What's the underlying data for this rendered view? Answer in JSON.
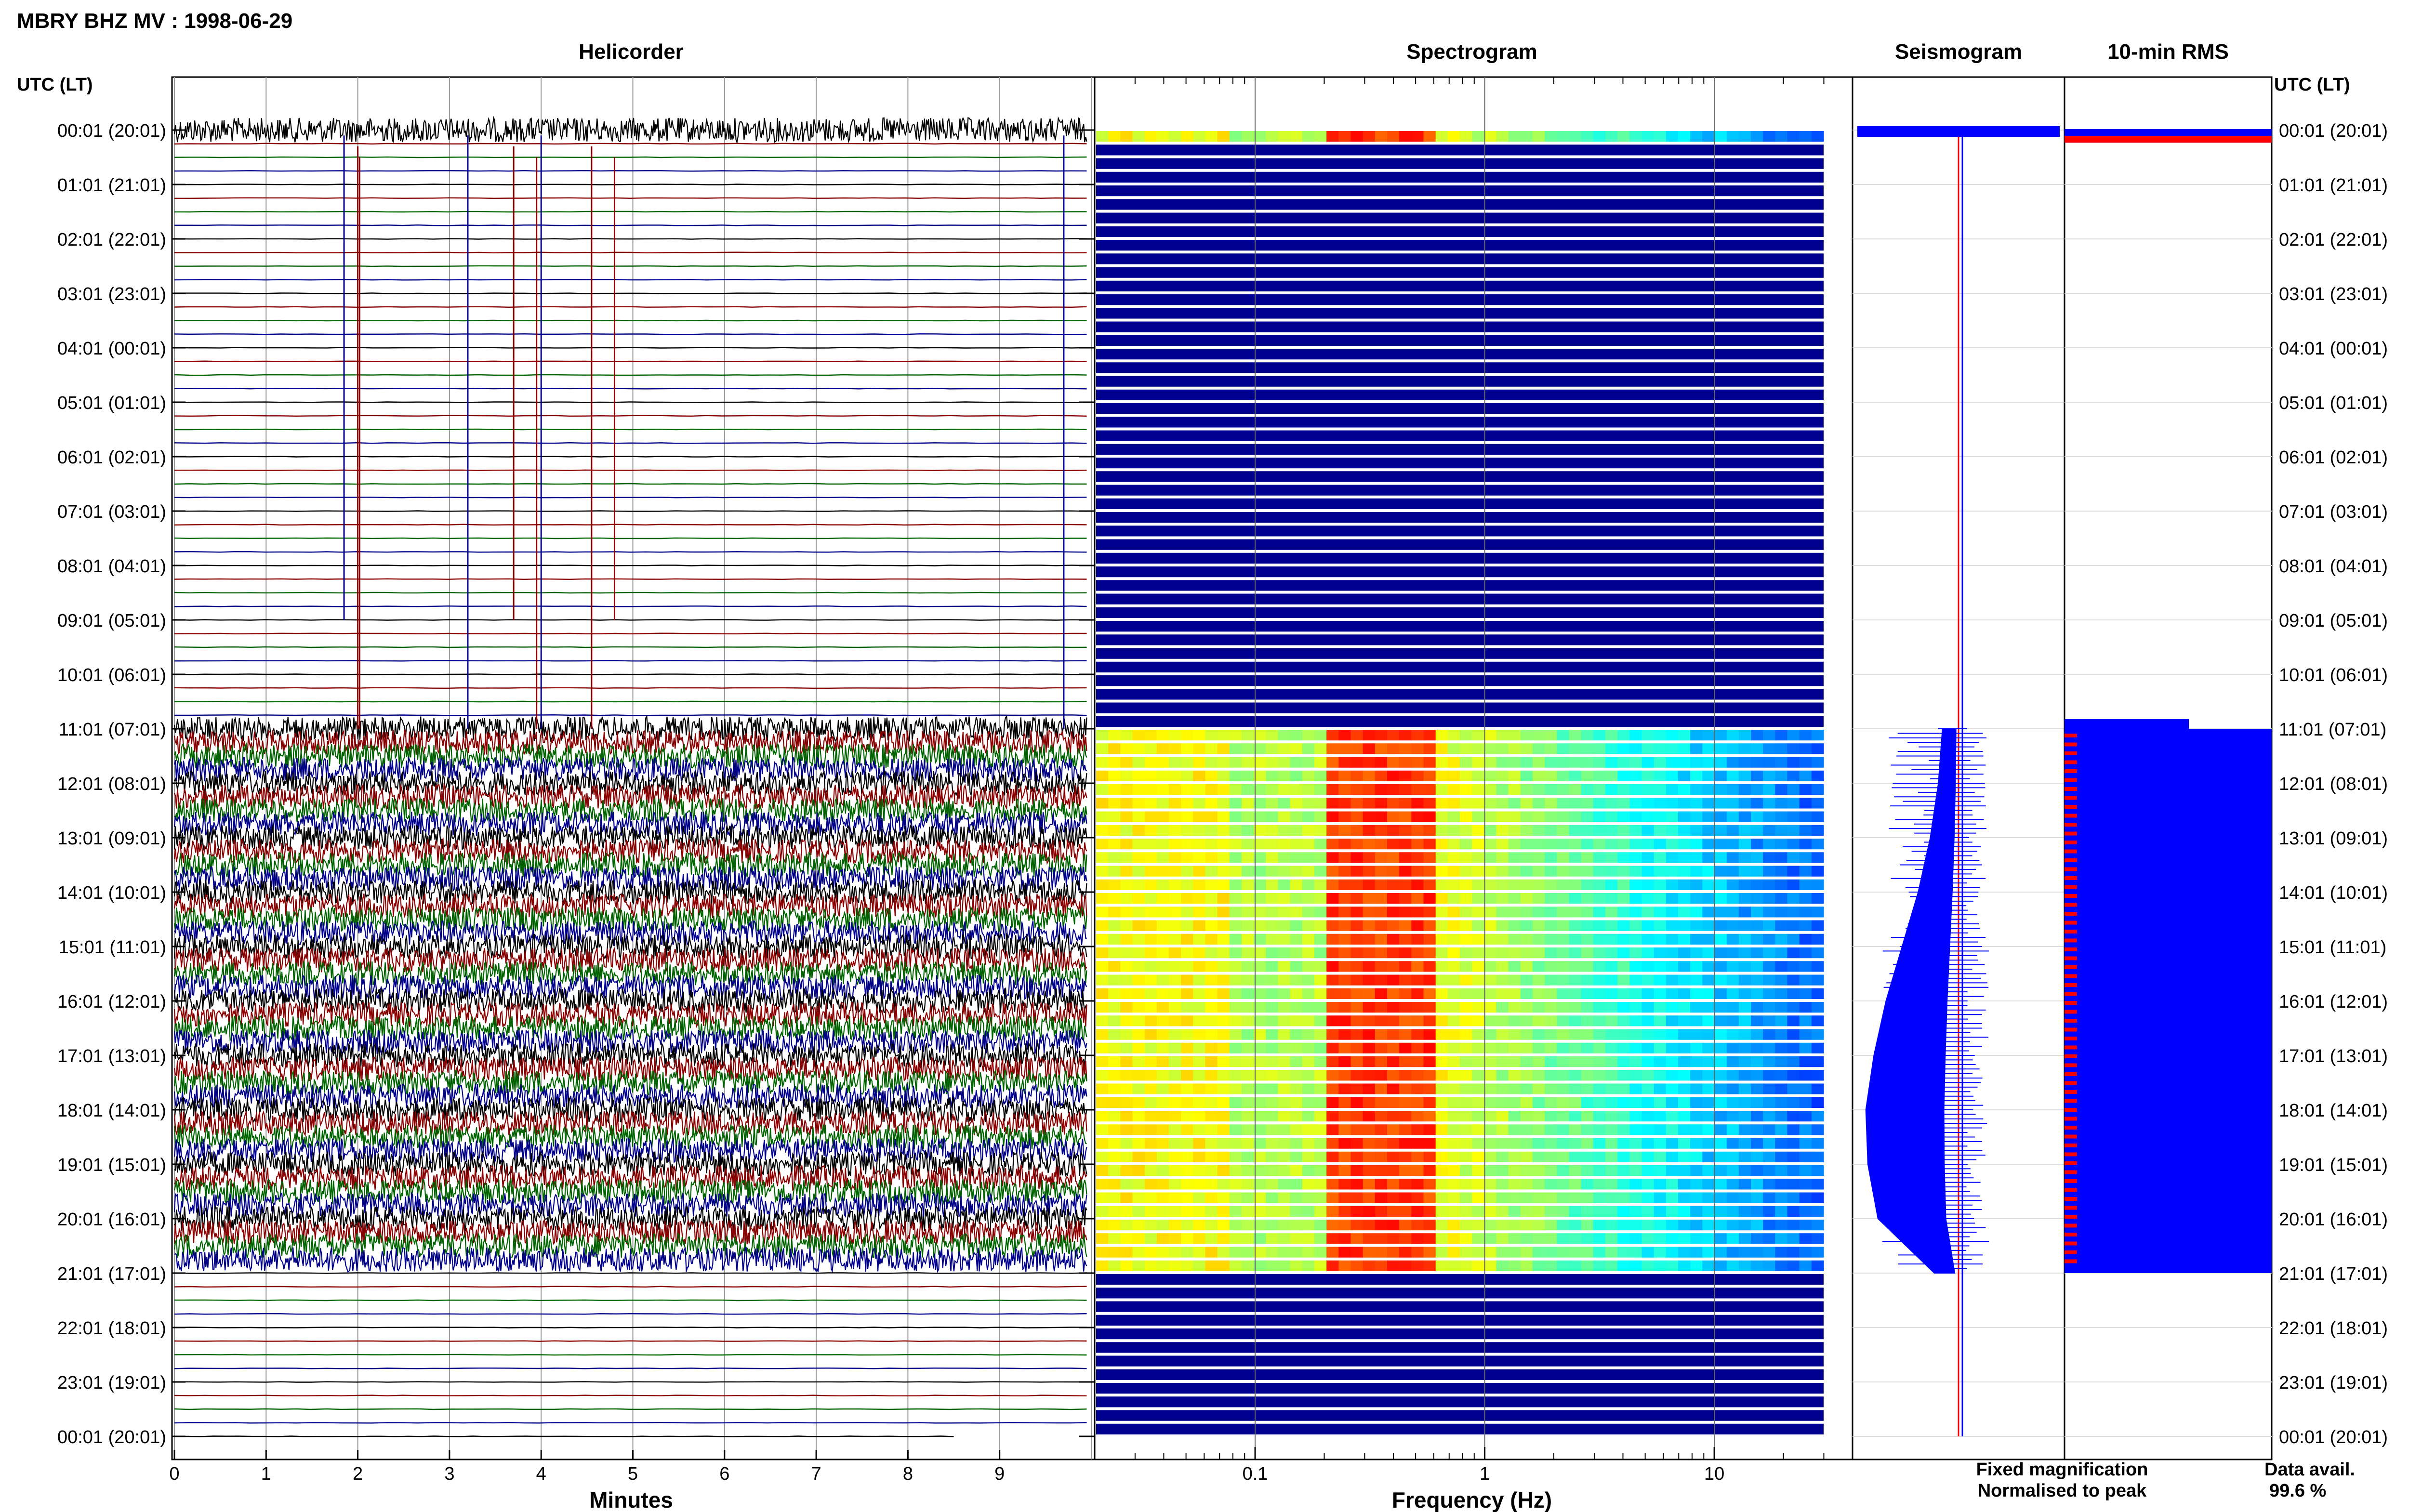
{
  "title": "MBRY BHZ MV : 1998-06-29",
  "panels": {
    "helicorder": "Helicorder",
    "spectrogram": "Spectrogram",
    "seismogram": "Seismogram",
    "rms": "10-min RMS"
  },
  "utc_lt_label": "UTC (LT)",
  "legend": {
    "fixed": "Fixed magnification",
    "normalised": "Normalised to peak",
    "fixed_color": "#0000ff",
    "normalised_color": "#ff0000"
  },
  "data_availability": {
    "label": "Data avail.",
    "value": "99.6 %"
  },
  "chart_data": [
    {
      "type": "line",
      "panel": "Helicorder",
      "xlabel": "Minutes",
      "xlim": [
        0,
        10
      ],
      "x_ticks": [
        "0",
        "1",
        "2",
        "3",
        "4",
        "5",
        "6",
        "7",
        "8",
        "9"
      ],
      "row_labels": [
        "00:01 (20:01)",
        "01:01 (21:01)",
        "02:01 (22:01)",
        "03:01 (23:01)",
        "04:01 (00:01)",
        "05:01 (01:01)",
        "06:01 (02:01)",
        "07:01 (03:01)",
        "08:01 (04:01)",
        "09:01 (05:01)",
        "10:01 (06:01)",
        "11:01 (07:01)",
        "12:01 (08:01)",
        "13:01 (09:01)",
        "14:01 (10:01)",
        "15:01 (11:01)",
        "16:01 (12:01)",
        "17:01 (13:01)",
        "18:01 (14:01)",
        "19:01 (15:01)",
        "20:01 (16:01)",
        "21:01 (17:01)",
        "22:01 (18:01)",
        "23:01 (19:01)",
        "00:01 (20:01)"
      ],
      "trace_colors": [
        "#000000",
        "#8b0000",
        "#006400",
        "#00008b"
      ],
      "active_rows_hours": [
        [
          0.0,
          0.25
        ],
        [
          11.0,
          21.0
        ]
      ],
      "noise_amplitude": {
        "quiet": 0.02,
        "active": 0.9
      },
      "spikes_minutes": [
        1.85,
        2.0,
        2.02,
        3.2,
        3.7,
        3.95,
        4.0,
        4.55,
        4.8,
        9.7
      ]
    },
    {
      "type": "heatmap",
      "panel": "Spectrogram",
      "xlabel": "Frequency (Hz)",
      "x_scale": "log",
      "xlim": [
        0.02,
        40
      ],
      "x_ticks": [
        "0.1",
        "1",
        "10"
      ],
      "colormap": "jet",
      "active_rows_hours": [
        [
          0.0,
          0.25
        ],
        [
          11.0,
          21.0
        ]
      ],
      "peak_band_hz": [
        0.2,
        0.6
      ]
    },
    {
      "type": "area",
      "panel": "Seismogram",
      "color": "#0000ff",
      "active_hours": [
        11.0,
        21.0
      ],
      "half_width_relative": [
        0.08,
        0.1,
        0.14,
        0.2,
        0.28,
        0.36,
        0.42,
        0.46,
        0.45,
        0.4,
        0.12
      ],
      "hours": [
        11,
        12,
        13,
        14,
        15,
        16,
        17,
        18,
        19,
        20,
        21
      ]
    },
    {
      "type": "bar",
      "panel": "10-min RMS",
      "fixed_color": "#0000ff",
      "normalised_color": "#ff0000",
      "active_hours": [
        11.0,
        21.0
      ],
      "fixed_level_relative": 1.0,
      "normalised_level_relative": 0.06
    }
  ]
}
